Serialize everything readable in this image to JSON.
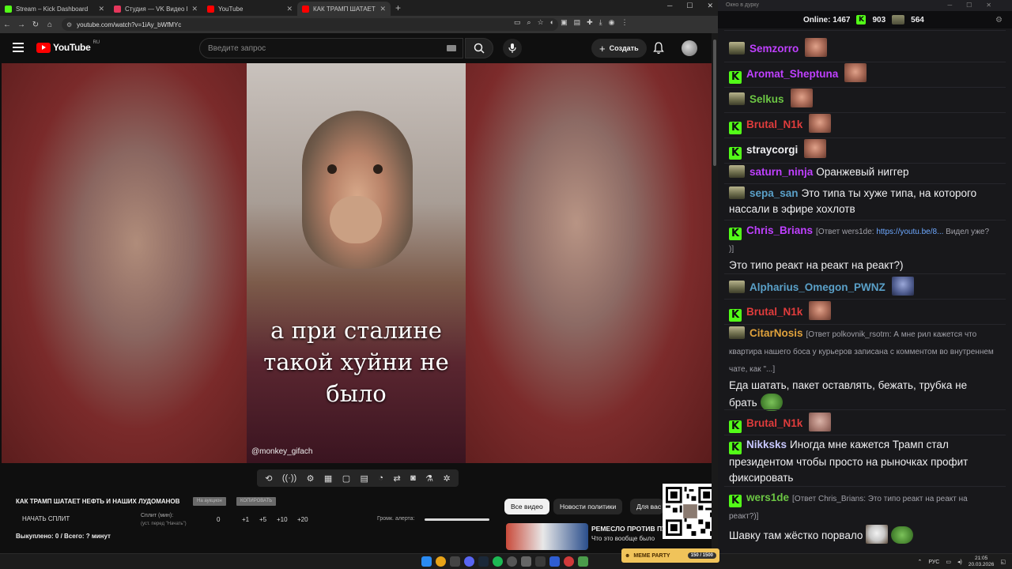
{
  "browser": {
    "tabs": [
      {
        "title": "Stream – Kick Dashboard",
        "color": "#53fc18",
        "active": false
      },
      {
        "title": "Студия — VK Видео Live",
        "color": "#e5375c",
        "active": false
      },
      {
        "title": "YouTube",
        "color": "#ff0000",
        "active": false
      },
      {
        "title": "КАК ТРАМП ШАТАЕТ НЕФ…",
        "color": "#ff0000",
        "active": true
      }
    ],
    "url": "youtube.com/watch?v=1iAy_bWfMYc"
  },
  "youtube": {
    "logo": "YouTube",
    "region": "RU",
    "search_placeholder": "Введите запрос",
    "create_label": "Создать"
  },
  "video": {
    "caption_lines": [
      "а при сталине",
      "такой хуйни не",
      "было"
    ],
    "watermark": "@monkey_gifach"
  },
  "overlay": {
    "title": "КАК ТРАМП ШАТАЕТ НЕФТЬ И НАШИХ ЛУДОМАНОВ",
    "btn_auction": "На аукцион",
    "btn_copy": "КОПИРОВАТЬ",
    "start_split": "НАЧАТЬ СПЛИТ",
    "split_label": "Сплит (мин):",
    "split_sub": "(уст. перед \"Начать\")",
    "split_value": "0",
    "steps": [
      "+1",
      "+5",
      "+10",
      "+20"
    ],
    "alert_label": "Громк. алерта:",
    "alert_volume": 1.0,
    "bought": "Выкуплено: 0 / Всего: ? минут"
  },
  "chips": [
    "Все видео",
    "Новости политики",
    "Для вас"
  ],
  "related": {
    "title": "РЕМЕСЛО ПРОТИВ ПУ",
    "subtitle": "Что это вообще было"
  },
  "chat": {
    "window_title": "Окно в дурку",
    "online_label": "Online:",
    "online": "1467",
    "kick_count": "903",
    "other_count": "564",
    "messages": [
      {
        "badge": "u",
        "user": "Semzorro",
        "color": "#bf40ff",
        "text": "",
        "emote": "face"
      },
      {
        "badge": "k",
        "user": "Aromat_Sheptuna",
        "color": "#bf40ff",
        "text": "",
        "emote": "face"
      },
      {
        "badge": "u",
        "user": "Selkus",
        "color": "#6cc644",
        "text": "",
        "emote": "face"
      },
      {
        "badge": "k",
        "user": "Brutal_N1k",
        "color": "#e03c3c",
        "text": "",
        "emote": "face"
      },
      {
        "badge": "k",
        "user": "straycorgi",
        "color": "#efeff1",
        "text": "",
        "emote": "face"
      },
      {
        "badge": "u",
        "user": "saturn_ninja",
        "color": "#bf40ff",
        "text": "Оранжевый ниггер"
      },
      {
        "badge": "u",
        "user": "sepa_san",
        "color": "#5aa0c8",
        "text": "Это типа ты хуже типа, на которого нассали в эфире хохлотв"
      },
      {
        "badge": "k",
        "user": "Chris_Brians",
        "color": "#bf40ff",
        "reply": "[Ответ wers1de: ",
        "link": "https://youtu.be/8...",
        "reply_tail": " Видел уже? )]",
        "text": "Это типо реакт на реакт на реакт?)"
      },
      {
        "badge": "u",
        "user": "Alpharius_Omegon_PWNZ",
        "color": "#5aa0c8",
        "text": "",
        "emote": "blue"
      },
      {
        "badge": "k",
        "user": "Brutal_N1k",
        "color": "#e03c3c",
        "text": "",
        "emote": "face"
      },
      {
        "badge": "u",
        "user": "CitarNosis",
        "color": "#e0a23c",
        "reply": "[Ответ polkovnik_rsotm: А мне рил кажется что квартира нашего боса у курьеров записана с комментом во внутреннем чате, как \"...]",
        "text": "Еда шатать, пакет оставлять, бежать, трубка не брать"
      },
      {
        "badge": "k",
        "user": "Brutal_N1k",
        "color": "#e03c3c",
        "text": "",
        "emote": "skin"
      },
      {
        "badge": "k",
        "user": "Nikksks",
        "color": "#c8c8ff",
        "text": "Иногда мне кажется Трамп стал президентом чтобы просто на рыночках профит фиксировать"
      },
      {
        "badge": "k",
        "user": "wers1de",
        "color": "#6cc644",
        "reply": "[Ответ Chris_Brians: Это типо реакт на реакт на реакт?)]",
        "text": "Шавку там жёстко порвало"
      }
    ]
  },
  "taskbar": {
    "meme_label": "MEME PARTY",
    "meme_progress": "150 / 1500",
    "lang": "РУС",
    "time": "21:05",
    "date": "20.03.2026"
  }
}
